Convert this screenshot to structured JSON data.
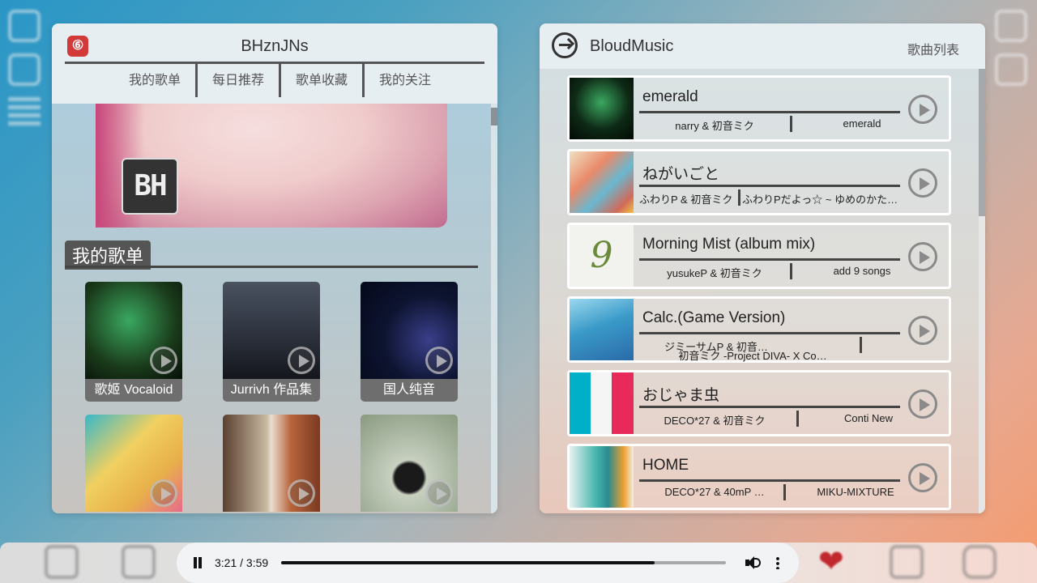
{
  "left_panel": {
    "logo_glyph": "⑥",
    "title": "BHznJNs",
    "tabs": [
      "我的歌单",
      "每日推荐",
      "歌单收藏",
      "我的关注"
    ],
    "banner_badge": "BH",
    "section_title": "我的歌单",
    "playlists": [
      {
        "label": "歌姬 Vocaloid",
        "color": "#1a3a1a"
      },
      {
        "label": "Jurrivh 作品集",
        "color": "#2a2f3a"
      },
      {
        "label": "国人纯音",
        "color": "#0d1430"
      },
      {
        "label": "",
        "color": "#e8b04a"
      },
      {
        "label": "",
        "color": "#7a5a3a"
      },
      {
        "label": "",
        "color": "#a8b5a0"
      }
    ]
  },
  "right_panel": {
    "title": "BloudMusic",
    "list_link": "歌曲列表",
    "songs": [
      {
        "name": "emerald",
        "artist": "narry & 初音ミク",
        "album": "emerald",
        "cover": "#0e2a16"
      },
      {
        "name": "ねがいごと",
        "artist": "ふわりP & 初音ミク",
        "album": "ふわりPだよっ☆ ~ ゆめのかた…",
        "cover": "#d06a5a"
      },
      {
        "name": "Morning Mist (album mix)",
        "artist": "yusukeP & 初音ミク",
        "album": "add 9 songs",
        "cover": "#f2f2ee"
      },
      {
        "name": "Calc.(Game Version)",
        "artist": "ジミーサムP & 初音…",
        "album": "初音ミク -Project DIVA- X Co…",
        "cover": "#3a9ac8"
      },
      {
        "name": "おじゃま虫",
        "artist": "DECO*27 & 初音ミク",
        "album": "Conti New",
        "cover": "#e82a5a"
      },
      {
        "name": "HOME",
        "artist": "DECO*27 & 40mP …",
        "album": "MIKU-MIXTURE",
        "cover": "#4ab8b0"
      }
    ]
  },
  "player": {
    "time": "3:21 / 3:59",
    "progress": 0.84
  },
  "colors": {
    "heart": "#c0282e",
    "accent": "#555555"
  }
}
